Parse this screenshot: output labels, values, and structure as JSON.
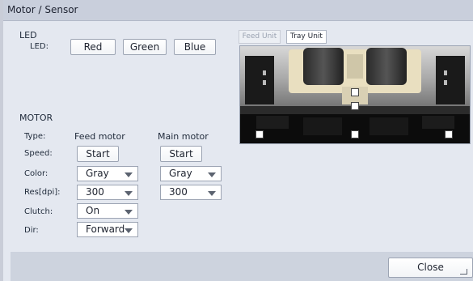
{
  "window": {
    "title": "Motor / Sensor"
  },
  "led": {
    "section_label": "LED",
    "row_label": "LED:",
    "buttons": [
      "Red",
      "Green",
      "Blue"
    ]
  },
  "motor": {
    "section_label": "MOTOR",
    "type_label": "Type:",
    "columns": [
      "Feed motor",
      "Main motor"
    ],
    "speed_label": "Speed:",
    "start_label": "Start",
    "color_label": "Color:",
    "res_label": "Res[dpi]:",
    "clutch_label": "Clutch:",
    "dir_label": "Dir:",
    "feed": {
      "color": "Gray",
      "res": "300",
      "clutch": "On",
      "dir": "Forward"
    },
    "main": {
      "color": "Gray",
      "res": "300"
    }
  },
  "unit_tabs": [
    "Feed Unit",
    "Tray Unit"
  ],
  "footer": {
    "close_label": "Close"
  }
}
